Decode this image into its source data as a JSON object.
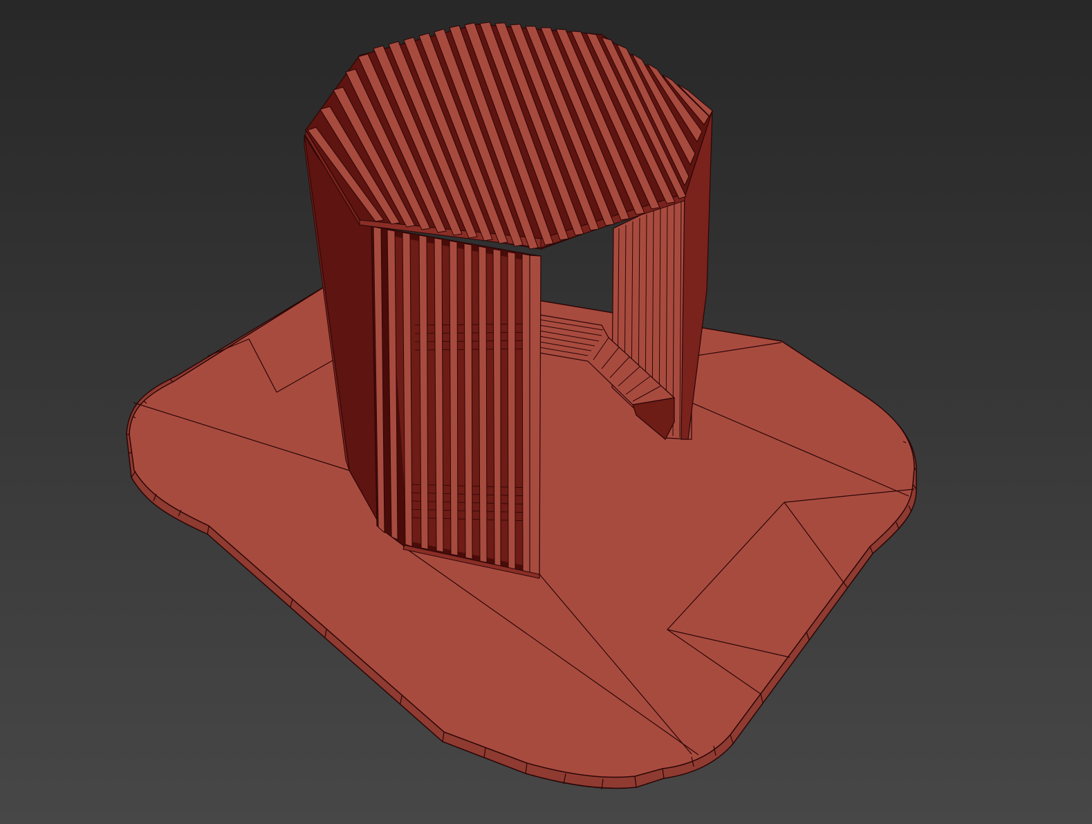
{
  "viewport": {
    "background_top": "#282828",
    "background_bottom": "#474747"
  },
  "model": {
    "material_color": "#a84b3f",
    "material_shadow": "#5e1410",
    "material_mid": "#8a2e26",
    "edge_color": "#2a0606",
    "objects": [
      "platform",
      "octagonal-pavilion",
      "slatted-roof",
      "vertical-slat-walls",
      "bench"
    ]
  }
}
